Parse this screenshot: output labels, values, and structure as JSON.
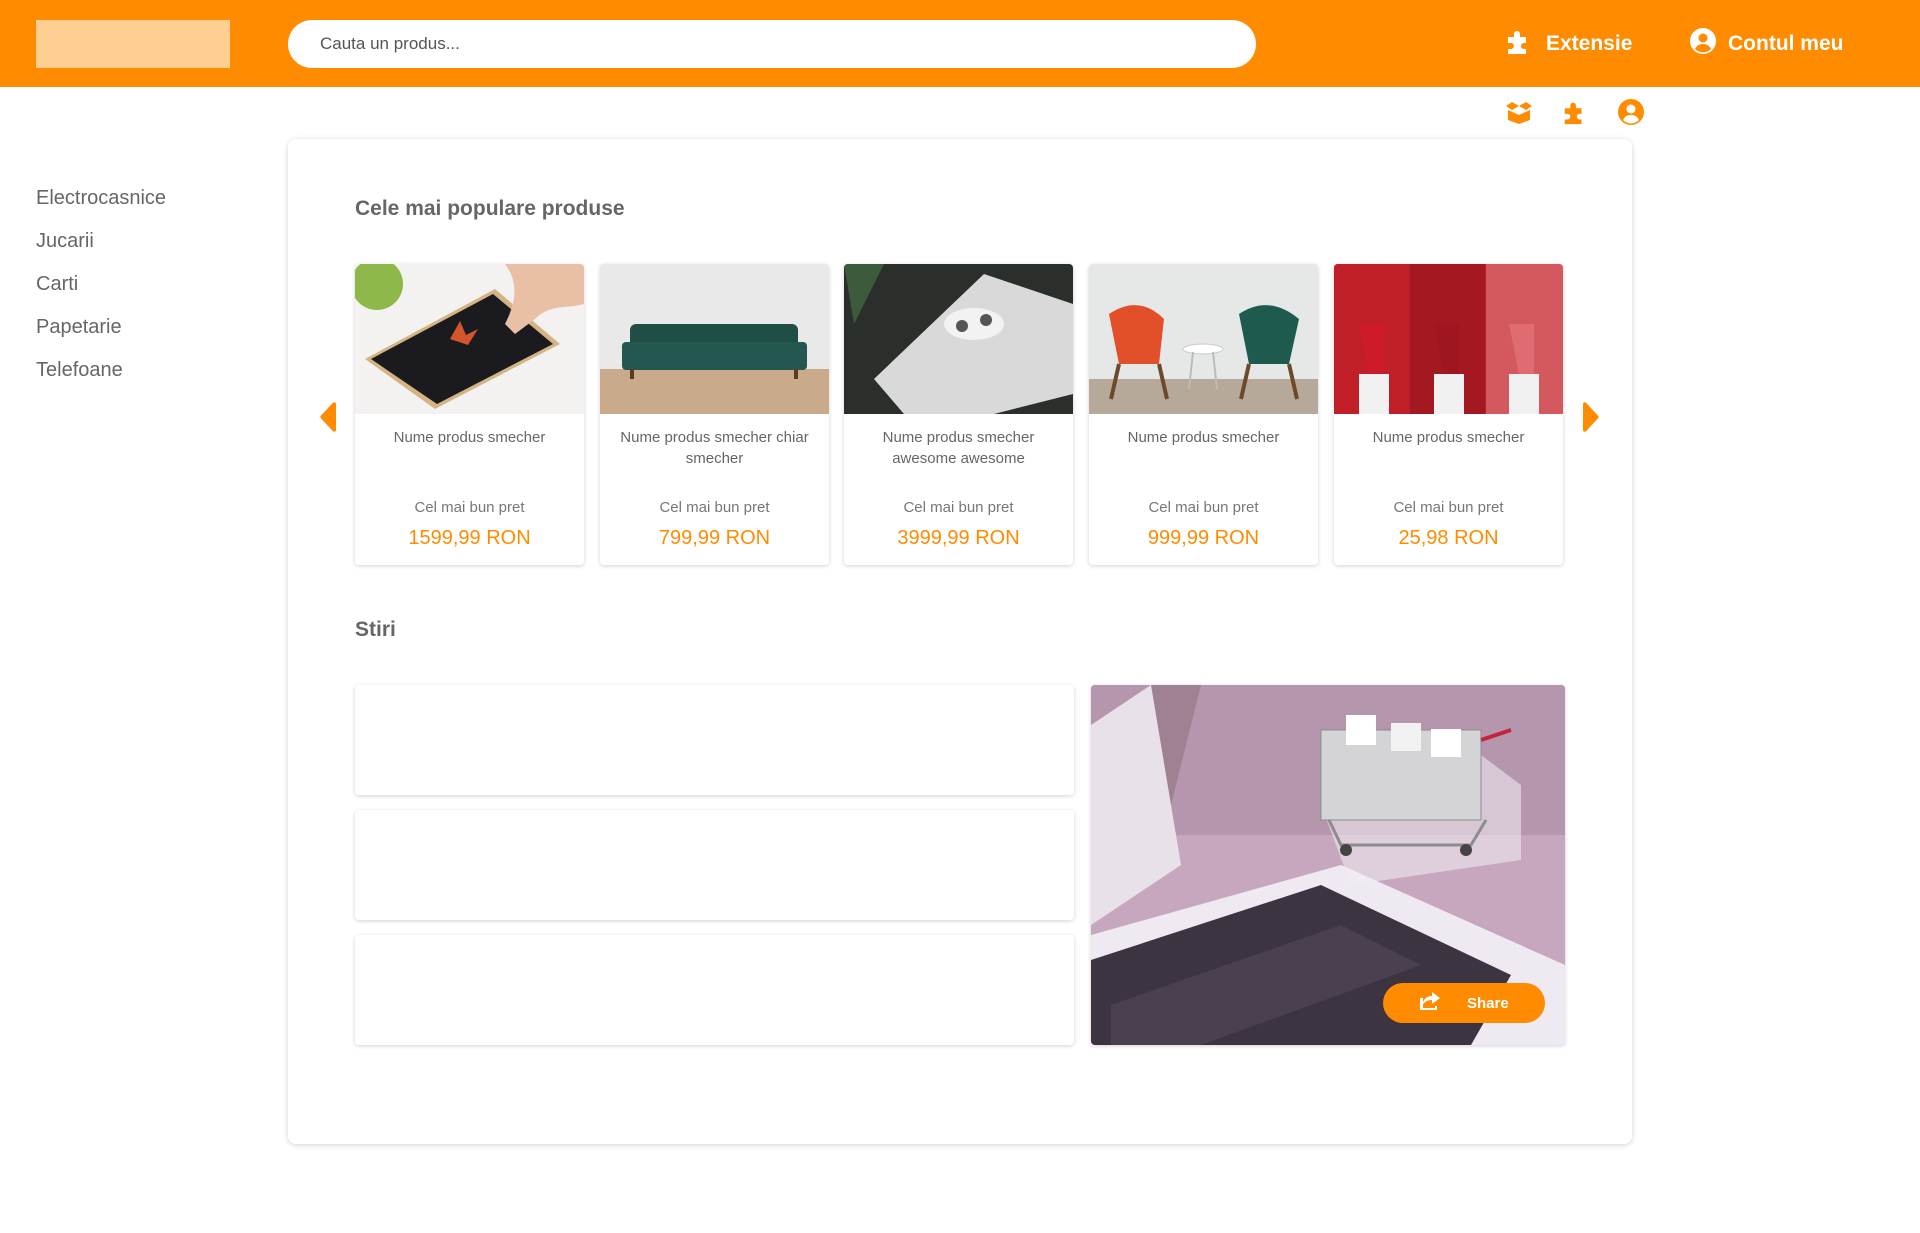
{
  "header": {
    "search_placeholder": "Cauta un produs...",
    "extension_label": "Extensie",
    "account_label": "Contul meu",
    "accent_color": "#ff8c00",
    "logo_placeholder_color": "#ffcf91"
  },
  "mini_icons": [
    "box-open-icon",
    "puzzle-icon",
    "user-circle-icon"
  ],
  "sidebar": {
    "items": [
      {
        "label": "Electrocasnice"
      },
      {
        "label": "Jucarii"
      },
      {
        "label": "Carti"
      },
      {
        "label": "Papetarie"
      },
      {
        "label": "Telefoane"
      }
    ]
  },
  "popular": {
    "title": "Cele mai populare produse",
    "products": [
      {
        "name": "Nume produs smecher",
        "best_label": "Cel mai bun pret",
        "price": "1599,99 RON",
        "image": "smartphone-photo"
      },
      {
        "name": "Nume produs smecher chiar smecher",
        "best_label": "Cel mai bun pret",
        "price": "799,99 RON",
        "image": "green-sofa-photo"
      },
      {
        "name": "Nume produs smecher awesome awesome",
        "best_label": "Cel mai bun pret",
        "price": "3999,99 RON",
        "image": "game-console-photo"
      },
      {
        "name": "Nume produs smecher",
        "best_label": "Cel mai bun pret",
        "price": "999,99 RON",
        "image": "chairs-photo"
      },
      {
        "name": "Nume produs smecher",
        "best_label": "Cel mai bun pret",
        "price": "25,98 RON",
        "image": "lipstick-photo"
      }
    ]
  },
  "news": {
    "title": "Stiri",
    "share_label": "Share"
  }
}
